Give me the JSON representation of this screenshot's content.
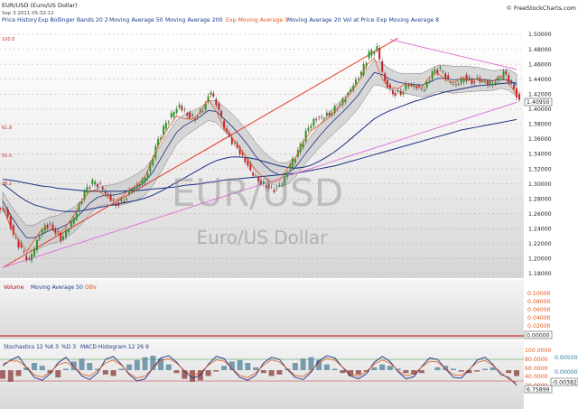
{
  "header": {
    "title": "EUR/USD (Euro/US Dollar)",
    "date": "Sep 3 2011 05:32:12",
    "source": "© FreeStockCharts.com"
  },
  "legend": [
    {
      "label": "Price History",
      "color": "#1a3a8a"
    },
    {
      "label": "Exp Bollinger Bands 20 2",
      "color": "#1a3a8a"
    },
    {
      "label": "Moving Average 50",
      "color": "#1a3a8a"
    },
    {
      "label": "Moving Average 200",
      "color": "#1a3a8a"
    },
    {
      "label": "Exp Moving Average 5",
      "color": "#e2591f"
    },
    {
      "label": "Moving Average 20",
      "color": "#1a3a8a"
    },
    {
      "label": "Vol at Price",
      "color": "#1a3a8a"
    },
    {
      "label": "Exp Moving Average 8",
      "color": "#1a3a8a"
    }
  ],
  "watermark": {
    "symbol": "EUR/USD",
    "name": "Euro/US Dollar"
  },
  "fib_labels": [
    "100.0",
    "61.8",
    "50.0",
    "38.2"
  ],
  "volume_panel": {
    "legend": [
      {
        "label": "Volume",
        "color": "#c00000"
      },
      {
        "label": "Moving Average 50",
        "color": "#1a3a8a"
      },
      {
        "label": "OBV",
        "color": "#e2591f"
      }
    ],
    "ticks": [
      "0.10000",
      "0.08000",
      "0.06000",
      "0.04000",
      "0.02000"
    ],
    "last_value": "0.00000"
  },
  "osc_panel": {
    "legend": [
      {
        "label": "Stochastics 12 %K 3",
        "color": "#1a3a8a"
      },
      {
        "label": "%D 3",
        "color": "#1a3a8a"
      },
      {
        "label": "MACD Histogram 12 26 9",
        "color": "#1a3a8a"
      }
    ],
    "left_ticks": [
      "100.0000",
      "80.0000",
      "60.0000",
      "40.0000",
      "20.0000"
    ],
    "right_ticks": [
      "0.00500",
      "0.00000"
    ],
    "stoch_value": "6.75899",
    "macd_value": "-0.00382"
  },
  "colors": {
    "up": "#2a9a2a",
    "down": "#c8202a",
    "blue_line": "#1a2f80",
    "ema": "#e2591f",
    "bands_fill": "#c9c9c9",
    "trend_red": "#e0392a",
    "trend_pink": "#e07ad8"
  },
  "chart_data": {
    "type": "line",
    "title": "EUR/USD (Euro/US Dollar)",
    "ytick_labels": [
      "1.50000",
      "1.48000",
      "1.46000",
      "1.44000",
      "1.42000",
      "1.40000",
      "1.38000",
      "1.36000",
      "1.34000",
      "1.32000",
      "1.30000",
      "1.28000",
      "1.26000",
      "1.24000",
      "1.22000",
      "1.20000",
      "1.18000"
    ],
    "ylim": [
      1.18,
      1.5
    ],
    "last_price": "1.40950",
    "series": [
      {
        "values": [
          1.265,
          1.231,
          1.212,
          1.196,
          1.223,
          1.245,
          1.242,
          1.227,
          1.241,
          1.262,
          1.288,
          1.302,
          1.297,
          1.283,
          1.272,
          1.279,
          1.293,
          1.3,
          1.314,
          1.348,
          1.374,
          1.392,
          1.405,
          1.393,
          1.388,
          1.4,
          1.424,
          1.398,
          1.366,
          1.352,
          1.336,
          1.318,
          1.305,
          1.298,
          1.292,
          1.3,
          1.325,
          1.342,
          1.368,
          1.385,
          1.389,
          1.394,
          1.404,
          1.416,
          1.432,
          1.448,
          1.474,
          1.481,
          1.436,
          1.421,
          1.422,
          1.434,
          1.43,
          1.426,
          1.448,
          1.453,
          1.438,
          1.432,
          1.443,
          1.437,
          1.44,
          1.434,
          1.436,
          1.448,
          1.433,
          1.41
        ]
      },
      {
        "values": [
          1.277,
          1.258,
          1.242,
          1.228,
          1.228,
          1.233,
          1.238,
          1.24,
          1.245,
          1.252,
          1.262,
          1.274,
          1.282,
          1.285,
          1.285,
          1.287,
          1.291,
          1.296,
          1.303,
          1.316,
          1.334,
          1.352,
          1.369,
          1.378,
          1.384,
          1.39,
          1.398,
          1.397,
          1.387,
          1.377,
          1.365,
          1.352,
          1.337,
          1.326,
          1.317,
          1.312,
          1.314,
          1.322,
          1.336,
          1.35,
          1.363,
          1.375,
          1.386,
          1.396,
          1.407,
          1.419,
          1.435,
          1.449,
          1.446,
          1.44,
          1.436,
          1.434,
          1.433,
          1.432,
          1.436,
          1.441,
          1.441,
          1.439,
          1.44,
          1.44,
          1.44,
          1.439,
          1.438,
          1.44,
          1.439,
          1.432
        ]
      },
      {
        "values": [
          1.3,
          1.292,
          1.284,
          1.277,
          1.272,
          1.269,
          1.266,
          1.264,
          1.263,
          1.263,
          1.264,
          1.266,
          1.268,
          1.27,
          1.272,
          1.274,
          1.276,
          1.278,
          1.281,
          1.285,
          1.29,
          1.296,
          1.302,
          1.308,
          1.314,
          1.32,
          1.326,
          1.331,
          1.334,
          1.336,
          1.336,
          1.335,
          1.333,
          1.33,
          1.327,
          1.324,
          1.322,
          1.321,
          1.322,
          1.325,
          1.33,
          1.336,
          1.343,
          1.351,
          1.36,
          1.369,
          1.378,
          1.387,
          1.393,
          1.398,
          1.402,
          1.406,
          1.41,
          1.413,
          1.417,
          1.42,
          1.423,
          1.425,
          1.427,
          1.429,
          1.431,
          1.432,
          1.433,
          1.434,
          1.435,
          1.435
        ]
      },
      {
        "values": [
          1.306,
          1.305,
          1.303,
          1.301,
          1.299,
          1.297,
          1.296,
          1.294,
          1.293,
          1.292,
          1.291,
          1.29,
          1.29,
          1.29,
          1.29,
          1.29,
          1.291,
          1.291,
          1.292,
          1.293,
          1.294,
          1.295,
          1.296,
          1.298,
          1.299,
          1.3,
          1.302,
          1.303,
          1.305,
          1.306,
          1.307,
          1.308,
          1.309,
          1.31,
          1.311,
          1.312,
          1.313,
          1.314,
          1.316,
          1.318,
          1.32,
          1.322,
          1.324,
          1.327,
          1.33,
          1.333,
          1.336,
          1.339,
          1.342,
          1.345,
          1.348,
          1.351,
          1.354,
          1.357,
          1.36,
          1.363,
          1.366,
          1.369,
          1.372,
          1.374,
          1.376,
          1.378,
          1.38,
          1.382,
          1.384,
          1.386
        ]
      }
    ],
    "trendlines": [
      {
        "from": [
          0,
          1.188
        ],
        "to": [
          50,
          1.495
        ]
      },
      {
        "from": [
          0,
          1.188
        ],
        "to": [
          65,
          1.409
        ]
      },
      {
        "from": [
          49,
          1.493
        ],
        "to": [
          65,
          1.453
        ]
      }
    ],
    "stochastics": [
      62,
      78,
      88,
      58,
      30,
      22,
      40,
      70,
      86,
      60,
      34,
      24,
      42,
      80,
      88,
      66,
      38,
      20,
      26,
      56,
      84,
      90,
      72,
      46,
      28,
      36,
      66,
      88,
      82,
      54,
      30,
      22,
      36,
      70,
      86,
      80,
      52,
      30,
      24,
      44,
      76,
      90,
      84,
      58,
      34,
      26,
      40,
      72,
      88,
      74,
      46,
      26,
      32,
      60,
      84,
      80,
      54,
      30,
      28,
      50,
      78,
      86,
      66,
      38,
      30,
      8
    ],
    "macd_hist": [
      -0.006,
      -0.008,
      -0.004,
      0.002,
      0.005,
      0.003,
      -0.002,
      -0.005,
      0.001,
      0.006,
      0.008,
      0.005,
      0.001,
      -0.003,
      -0.004,
      0.001,
      0.004,
      0.007,
      0.009,
      0.01,
      0.008,
      0.004,
      -0.002,
      -0.006,
      -0.008,
      -0.007,
      -0.004,
      -0.001,
      0.003,
      0.006,
      0.007,
      0.005,
      0.002,
      -0.002,
      -0.004,
      -0.003,
      0.001,
      0.005,
      0.008,
      0.009,
      0.007,
      0.004,
      0.001,
      -0.002,
      -0.004,
      -0.003,
      -0.001,
      0.002,
      0.004,
      0.003,
      0.001,
      -0.002,
      -0.003,
      -0.002,
      0.0,
      0.002,
      0.003,
      0.001,
      -0.001,
      -0.002,
      -0.001,
      0.001,
      0.002,
      0.0,
      -0.002,
      -0.004
    ]
  }
}
